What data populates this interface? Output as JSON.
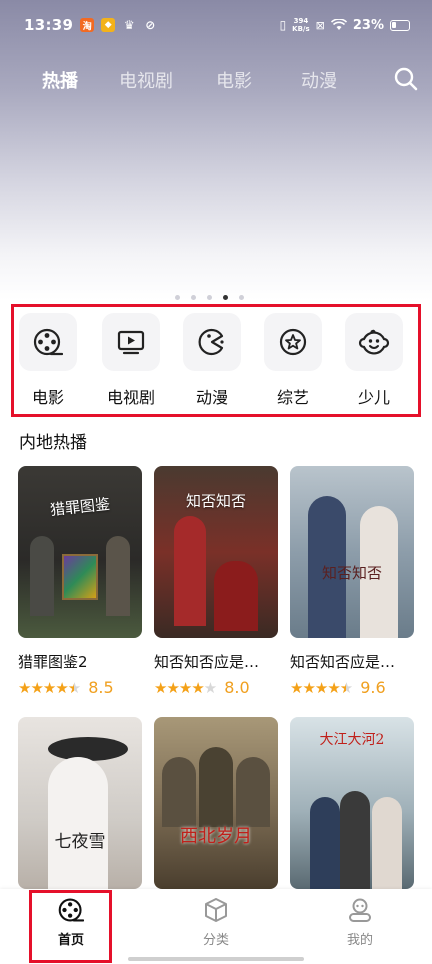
{
  "status_bar": {
    "time": "13:39",
    "app_icons": [
      "淘",
      "🦊",
      "♛",
      "↗"
    ],
    "net_speed_value": "394",
    "net_speed_unit": "KB/s",
    "battery": "23%"
  },
  "top_nav": {
    "tabs": [
      {
        "label": "热播",
        "active": true
      },
      {
        "label": "电视剧",
        "active": false
      },
      {
        "label": "电影",
        "active": false
      },
      {
        "label": "动漫",
        "active": false
      }
    ],
    "search_icon": "search-icon"
  },
  "carousel": {
    "page_count": 5,
    "active_index": 3
  },
  "categories": [
    {
      "label": "电影",
      "icon": "film-reel-icon"
    },
    {
      "label": "电视剧",
      "icon": "tv-play-icon"
    },
    {
      "label": "动漫",
      "icon": "pacman-icon"
    },
    {
      "label": "综艺",
      "icon": "star-circle-icon"
    },
    {
      "label": "少儿",
      "icon": "baby-face-icon"
    }
  ],
  "section": {
    "title": "内地热播",
    "items": [
      {
        "title": "猎罪图鉴2",
        "rating": 8.5,
        "stars": 4.5,
        "poster_text": "猎罪图鉴",
        "bg": "#2b2a28"
      },
      {
        "title": "知否知否应是…",
        "rating": 8.0,
        "stars": 4.0,
        "poster_text": "知否知否",
        "bg": "#6b2a24"
      },
      {
        "title": "知否知否应是…",
        "rating": 9.6,
        "stars": 4.5,
        "poster_text": "知否知否",
        "bg": "#8a9aa8"
      },
      {
        "title": "",
        "rating": null,
        "stars": null,
        "poster_text": "七夜雪",
        "bg": "#cfcbc6"
      },
      {
        "title": "",
        "rating": null,
        "stars": null,
        "poster_text": "西北岁月",
        "bg": "#7a6a52"
      },
      {
        "title": "",
        "rating": null,
        "stars": null,
        "poster_text": "大江大河2",
        "bg": "#9fb0b8"
      }
    ]
  },
  "bottom_nav": {
    "items": [
      {
        "label": "首页",
        "icon": "film-reel-icon",
        "active": true
      },
      {
        "label": "分类",
        "icon": "cube-icon",
        "active": false
      },
      {
        "label": "我的",
        "icon": "user-icon",
        "active": false
      }
    ]
  },
  "colors": {
    "highlight": "#e5102a",
    "star": "#f4a118",
    "score": "#f0a020"
  }
}
